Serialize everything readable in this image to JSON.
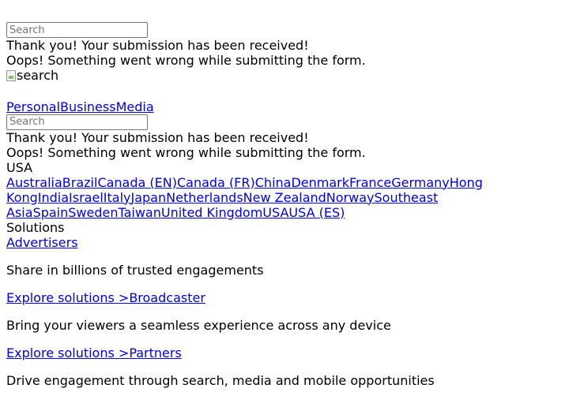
{
  "search": {
    "placeholder": "Search"
  },
  "form": {
    "success": "Thank you! Your submission has been received!",
    "error": "Oops! Something went wrong while submitting the form."
  },
  "search_image": {
    "alt": "search"
  },
  "nav": {
    "tabs": [
      "Personal",
      "Business",
      "Media"
    ]
  },
  "region": {
    "current": "USA",
    "countries": [
      "Australia",
      "Brazil",
      "Canada (EN)",
      "Canada (FR)",
      "China",
      "Denmark",
      "France",
      "Germany",
      "Hong Kong",
      "India",
      "Israel",
      "Italy",
      "Japan",
      "Netherlands",
      "New Zealand",
      "Norway",
      "Southeast Asia",
      "Spain",
      "Sweden",
      "Taiwan",
      "United Kingdom",
      "USA",
      "USA (ES)"
    ]
  },
  "solutions": {
    "heading": "Solutions",
    "items": [
      {
        "title": "Advertisers",
        "description": "Share in billions of trusted engagements",
        "cta": "Explore solutions >"
      },
      {
        "title": "Broadcaster",
        "description": "Bring your viewers a seamless experience across any device",
        "cta": "Explore solutions >"
      },
      {
        "title": "Partners",
        "description": "Drive engagement through search, media and mobile opportunities",
        "cta": ""
      }
    ]
  }
}
